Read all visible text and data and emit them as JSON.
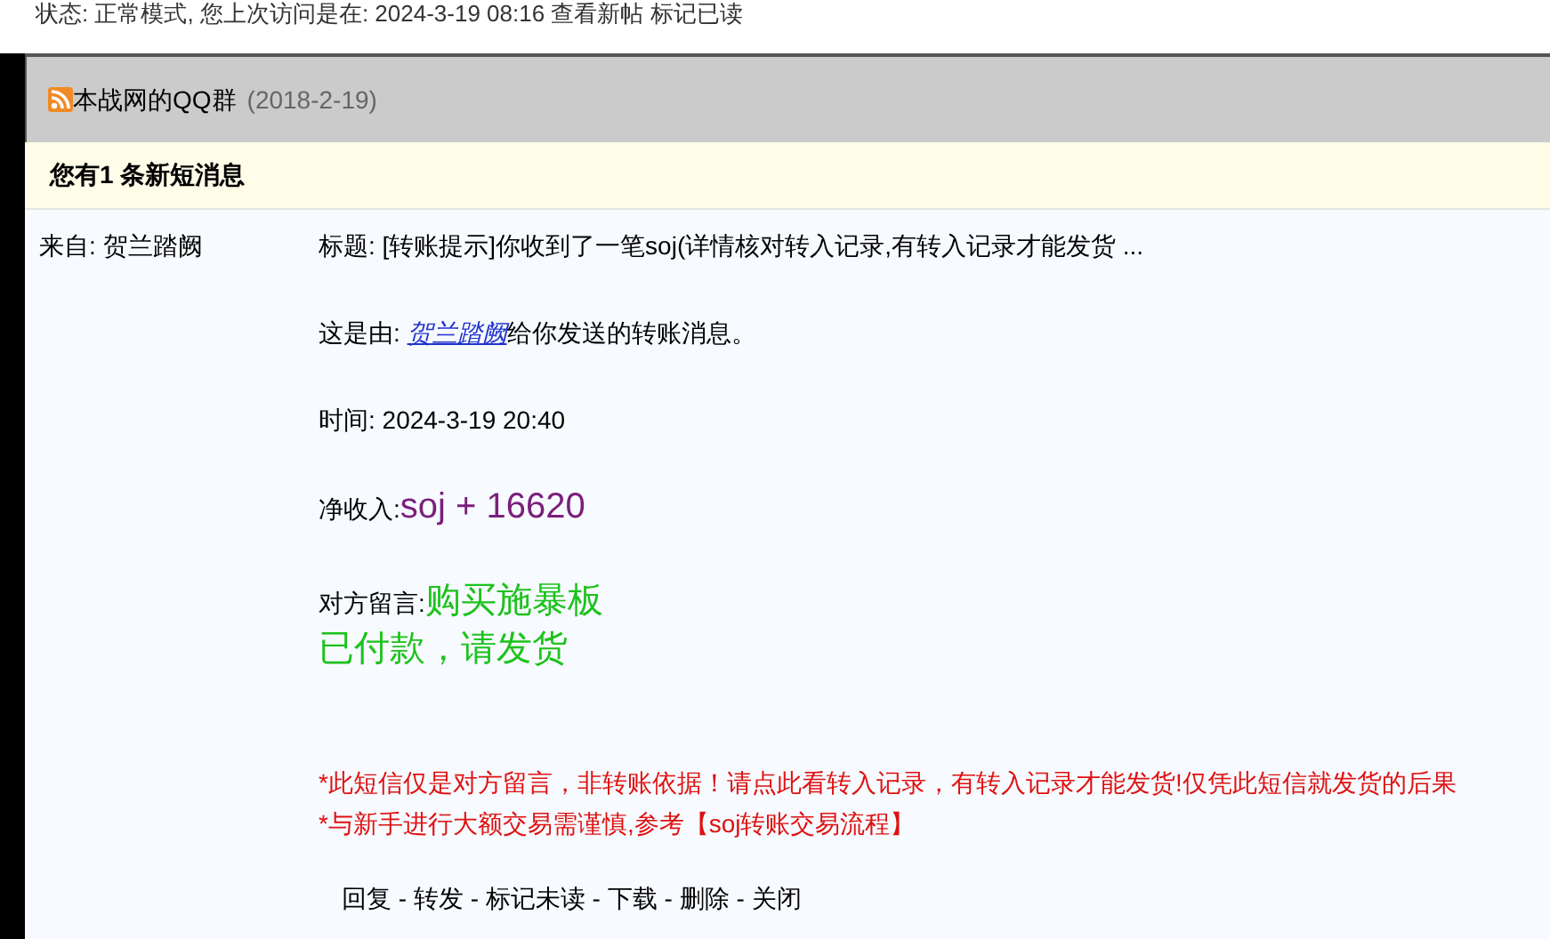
{
  "status_line": {
    "text": "状态: 正常模式, 您上次访问是在: 2024-3-19 08:16",
    "links": [
      "查看新帖",
      "标记已读"
    ]
  },
  "board": {
    "title": "本战网的QQ群",
    "date": "(2018-2-19)"
  },
  "notice": "您有1 条新短消息",
  "message": {
    "from": "来自: 贺兰踏阙",
    "subject": "标题: [转账提示]你收到了一笔soj(详情核对转入记录,有转入记录才能发货 ...",
    "sender_prefix": "这是由: ",
    "sender": "贺兰踏阙",
    "sender_suffix": "给你发送的转账消息。",
    "time": "时间: 2024-3-19 20:40",
    "income_label": "净收入:",
    "income": "soj + 16620",
    "remark_label": "对方留言:",
    "remark_lines": [
      "购买施暴板",
      "已付款，请发货"
    ],
    "warnings": [
      "*此短信仅是对方留言，非转账依据！请点此看转入记录，有转入记录才能发货!仅凭此短信就发货的后果",
      "*与新手进行大额交易需谨慎,参考【soj转账交易流程】"
    ]
  },
  "actions": {
    "separator": "-",
    "items": [
      "回复",
      "转发",
      "标记未读",
      "下载",
      "删除",
      "关闭"
    ]
  }
}
